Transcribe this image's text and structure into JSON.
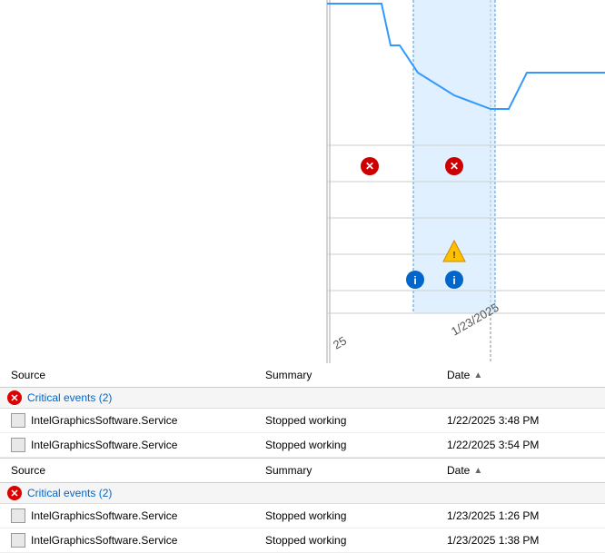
{
  "chart": {
    "highlight_color": "#cce6ff",
    "line_color": "#3399ff",
    "error_color": "#cc0000",
    "warning_color": "#ffa500",
    "info_color": "#0066cc"
  },
  "table": {
    "columns": [
      "Source",
      "Summary",
      "Date"
    ],
    "sort_column": "Date",
    "sort_icon": "▲",
    "groups": [
      {
        "label": "Critical events (2)",
        "rows": [
          {
            "source": "IntelGraphicsSoftware.Service",
            "summary": "Stopped working",
            "date": "1/22/2025 3:48 PM"
          },
          {
            "source": "IntelGraphicsSoftware.Service",
            "summary": "Stopped working",
            "date": "1/22/2025 3:54 PM"
          }
        ]
      }
    ],
    "groups2": [
      {
        "label": "Critical events (2)",
        "rows": [
          {
            "source": "IntelGraphicsSoftware.Service",
            "summary": "Stopped working",
            "date": "1/23/2025 1:26 PM"
          },
          {
            "source": "IntelGraphicsSoftware.Service",
            "summary": "Stopped working",
            "date": "1/23/2025 1:38 PM"
          }
        ]
      }
    ],
    "columns2": [
      "Source",
      "Summary",
      "Date"
    ],
    "sort_icon2": "▲"
  },
  "dates": {
    "left": "25",
    "right": "1/23/2025"
  }
}
